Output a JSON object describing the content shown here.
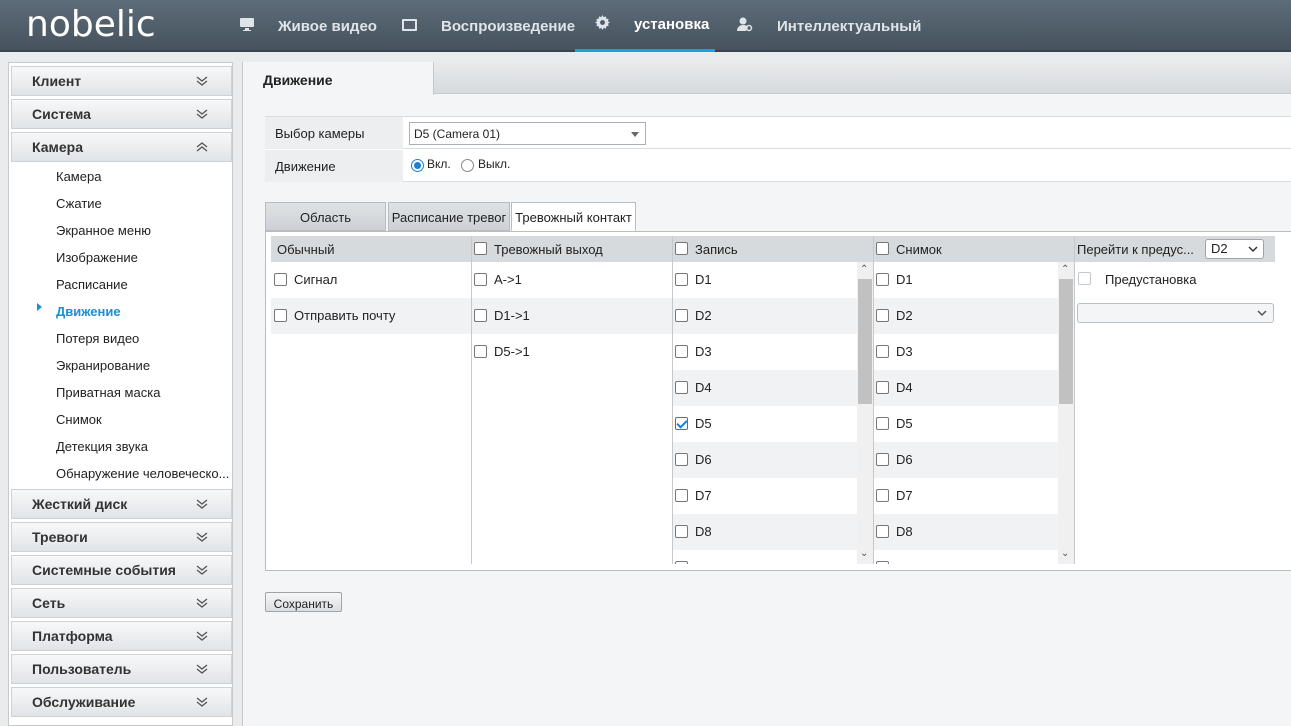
{
  "app": {
    "logo": "nobelic"
  },
  "nav": {
    "items": [
      {
        "label": "Живое видео",
        "icon": "monitor-icon"
      },
      {
        "label": "Воспроизведение",
        "icon": "film-icon"
      },
      {
        "label": "установка",
        "icon": "gear-icon",
        "active": true
      },
      {
        "label": "Интеллектуальный",
        "icon": "user-search-icon"
      }
    ]
  },
  "sidebar": {
    "sections_top": [
      {
        "label": "Клиент",
        "expanded": false
      },
      {
        "label": "Система",
        "expanded": false
      },
      {
        "label": "Камера",
        "expanded": true
      }
    ],
    "camera_items": [
      "Камера",
      "Сжатие",
      "Экранное меню",
      "Изображение",
      "Расписание",
      "Движение",
      "Потеря видео",
      "Экранирование",
      "Приватная маска",
      "Снимок",
      "Детекция звука",
      "Обнаружение человеческо..."
    ],
    "active_item": "Движение",
    "sections_bottom": [
      {
        "label": "Жесткий диск"
      },
      {
        "label": "Тревоги"
      },
      {
        "label": "Системные события"
      },
      {
        "label": "Сеть"
      },
      {
        "label": "Платформа"
      },
      {
        "label": "Пользователь"
      },
      {
        "label": "Обслуживание"
      }
    ]
  },
  "page": {
    "tab": "Движение"
  },
  "form": {
    "camera_label": "Выбор камеры",
    "camera_value": "D5 (Camera 01)",
    "motion_label": "Движение",
    "on_label": "Вкл.",
    "off_label": "Выкл.",
    "motion_on": true
  },
  "subtabs": [
    {
      "label": "Область"
    },
    {
      "label": "Расписание тревог"
    },
    {
      "label": "Тревожный контакт",
      "active": true
    }
  ],
  "grid": {
    "normal": {
      "header": "Обычный",
      "items": [
        {
          "label": "Сигнал",
          "checked": false
        },
        {
          "label": "Отправить почту",
          "checked": false
        }
      ]
    },
    "alarm_out": {
      "header": "Тревожный выход",
      "items": [
        {
          "label": "A->1",
          "checked": false
        },
        {
          "label": "D1->1",
          "checked": false
        },
        {
          "label": "D5->1",
          "checked": false
        }
      ]
    },
    "record": {
      "header": "Запись",
      "items": [
        {
          "label": "D1",
          "checked": false
        },
        {
          "label": "D2",
          "checked": false
        },
        {
          "label": "D3",
          "checked": false
        },
        {
          "label": "D4",
          "checked": false
        },
        {
          "label": "D5",
          "checked": true
        },
        {
          "label": "D6",
          "checked": false
        },
        {
          "label": "D7",
          "checked": false
        },
        {
          "label": "D8",
          "checked": false
        }
      ]
    },
    "snapshot": {
      "header": "Снимок",
      "items": [
        {
          "label": "D1",
          "checked": false
        },
        {
          "label": "D2",
          "checked": false
        },
        {
          "label": "D3",
          "checked": false
        },
        {
          "label": "D4",
          "checked": false
        },
        {
          "label": "D5",
          "checked": false
        },
        {
          "label": "D6",
          "checked": false
        },
        {
          "label": "D7",
          "checked": false
        },
        {
          "label": "D8",
          "checked": false
        }
      ]
    },
    "preset": {
      "header": "Перейти к предус...",
      "channel": "D2",
      "item_label": "Предустановка",
      "dropdown_value": ""
    }
  },
  "buttons": {
    "save": "Сохранить"
  }
}
